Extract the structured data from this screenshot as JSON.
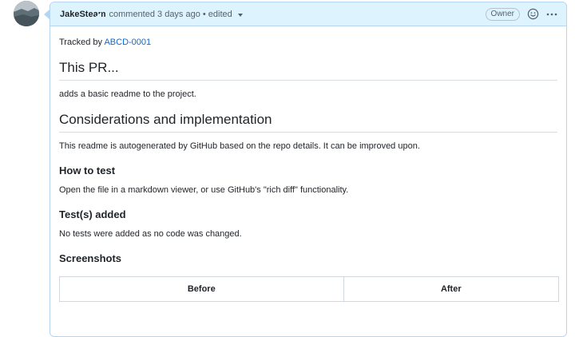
{
  "header": {
    "author": "JakeSteam",
    "meta": "commented 3 days ago • edited",
    "badge": "Owner"
  },
  "body": {
    "tracked_prefix": "Tracked by ",
    "tracked_link": "ABCD-0001",
    "sections": [
      {
        "title": "This PR...",
        "text": "adds a basic readme to the project."
      },
      {
        "title": "Considerations and implementation",
        "text": "This readme is autogenerated by GitHub based on the repo details. It can be improved upon."
      },
      {
        "title": "How to test",
        "text": "Open the file in a markdown viewer, or use GitHub's \"rich diff\" functionality."
      },
      {
        "title": "Test(s) added",
        "text": "No tests were added as no code was changed."
      },
      {
        "title": "Screenshots"
      }
    ],
    "table": {
      "headers": [
        "Before",
        "After"
      ]
    }
  },
  "icons": {
    "emoji": "smiley-icon",
    "more": "kebab-horizontal-icon",
    "caret": "triangle-down-icon"
  }
}
